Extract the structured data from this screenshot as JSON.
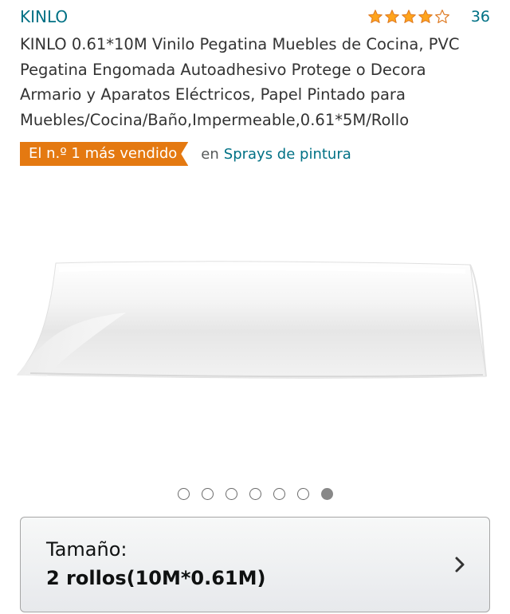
{
  "product": {
    "brand": "KINLO",
    "rating_stars": 4,
    "rating_max": 5,
    "review_count": "36",
    "title": "KINLO 0.61*10M Vinilo Pegatina Muebles de Cocina, PVC Pegatina Engomada Autoadhesivo Protege o Decora Armario y Aparatos Eléctricos, Papel Pintado para Muebles/Cocina/Baño,Impermeable,0.61*5M/Rollo"
  },
  "bestseller": {
    "badge": "El n.º 1 más vendido",
    "in_label": "en",
    "category": "Sprays de pintura"
  },
  "carousel": {
    "count": 7,
    "active_index": 6
  },
  "variation": {
    "label": "Tamaño:",
    "value": "2 rollos(10M*0.61M)"
  },
  "colors": {
    "link": "#007185",
    "badge": "#e47911",
    "star": "#ffa41c"
  },
  "icons": {
    "star": "star-icon",
    "chevron": "chevron-right-icon"
  }
}
